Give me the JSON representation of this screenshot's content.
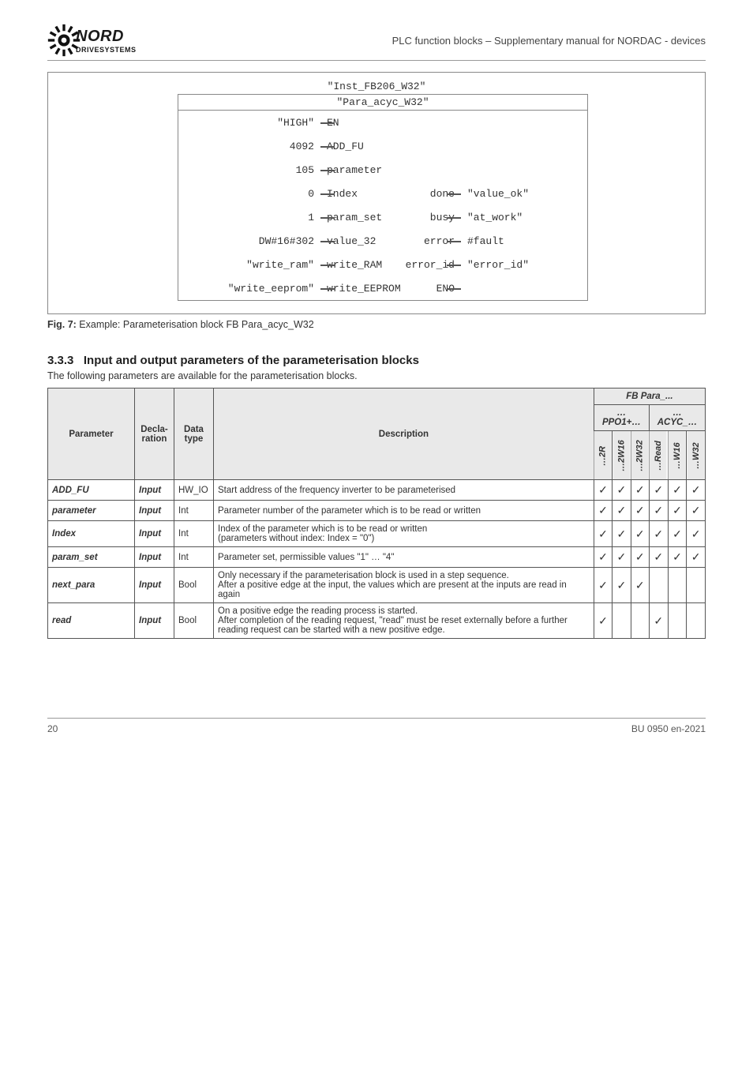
{
  "header": {
    "brand_top": "NORD",
    "brand_sub": "DRIVESYSTEMS",
    "right": "PLC function blocks – Supplementary manual for NORDAC - devices"
  },
  "fb": {
    "title": "\"Inst_FB206_W32\"",
    "subtitle": "\"Para_acyc_W32\"",
    "rows_left": [
      {
        "val": "\"HIGH\"",
        "port": "EN"
      },
      {
        "val": "4092",
        "port": "ADD_FU"
      },
      {
        "val": "105",
        "port": "parameter"
      },
      {
        "val": "0",
        "port": "Index"
      },
      {
        "val": "1",
        "port": "param_set"
      },
      {
        "val": "DW#16#302",
        "port": "value_32"
      },
      {
        "val": "\"write_ram\"",
        "port": "write_RAM"
      },
      {
        "val": "\"write_eeprom\"",
        "port": "write_EEPROM"
      }
    ],
    "rows_right": [
      {
        "port": "done",
        "val": "\"value_ok\""
      },
      {
        "port": "busy",
        "val": "\"at_work\""
      },
      {
        "port": "error",
        "val": "#fault"
      },
      {
        "port": "error_id",
        "val": "\"error_id\""
      },
      {
        "port": "ENO",
        "val": ""
      }
    ]
  },
  "caption": {
    "label": "Fig. 7:",
    "text": "Example: Parameterisation block FB Para_acyc_W32"
  },
  "section": {
    "num": "3.3.3",
    "title": "Input and output parameters of the parameterisation blocks",
    "desc": "The following parameters are available for the parameterisation blocks."
  },
  "thead": {
    "c1": "Parameter",
    "c2": "Decla-\nration",
    "c3": "Data type",
    "c4": "Description",
    "group_top": "FB Para_...",
    "g1": "…PPO1+…",
    "g2": "…ACYC_…",
    "sub": [
      "…2R",
      "…2W16",
      "…2W32",
      "…Read",
      "…W16",
      "…W32"
    ]
  },
  "rows": [
    {
      "name": "ADD_FU",
      "type": "Input",
      "dtype": "HW_IO",
      "desc": "Start address of the frequency inverter to be parameterised",
      "c": [
        "✓",
        "✓",
        "✓",
        "✓",
        "✓",
        "✓"
      ]
    },
    {
      "name": "parameter",
      "type": "Input",
      "dtype": "Int",
      "desc": "Parameter number of the parameter which is to be read or written",
      "c": [
        "✓",
        "✓",
        "✓",
        "✓",
        "✓",
        "✓"
      ]
    },
    {
      "name": "Index",
      "type": "Input",
      "dtype": "Int",
      "desc": "Index of the parameter which is to be read or written\n(parameters without index: Index = \"0\")",
      "c": [
        "✓",
        "✓",
        "✓",
        "✓",
        "✓",
        "✓"
      ]
    },
    {
      "name": "param_set",
      "type": "Input",
      "dtype": "Int",
      "desc": "Parameter set, permissible values \"1\" … \"4\"",
      "c": [
        "✓",
        "✓",
        "✓",
        "✓",
        "✓",
        "✓"
      ]
    },
    {
      "name": "next_para",
      "type": "Input",
      "dtype": "Bool",
      "desc": "Only necessary if the parameterisation block is used in a step sequence.\nAfter a positive edge at the input, the values which are present at the inputs are read in again",
      "c": [
        "✓",
        "✓",
        "✓",
        "",
        "",
        ""
      ]
    },
    {
      "name": "read",
      "type": "Input",
      "dtype": "Bool",
      "desc": "On a positive edge the reading process is started.\nAfter completion of the reading request, \"read\" must be reset externally before a further reading request can be started with a new positive edge.",
      "c": [
        "✓",
        "",
        "",
        "✓",
        "",
        ""
      ]
    }
  ],
  "footer": {
    "left": "20",
    "right": "BU 0950 en-2021"
  }
}
